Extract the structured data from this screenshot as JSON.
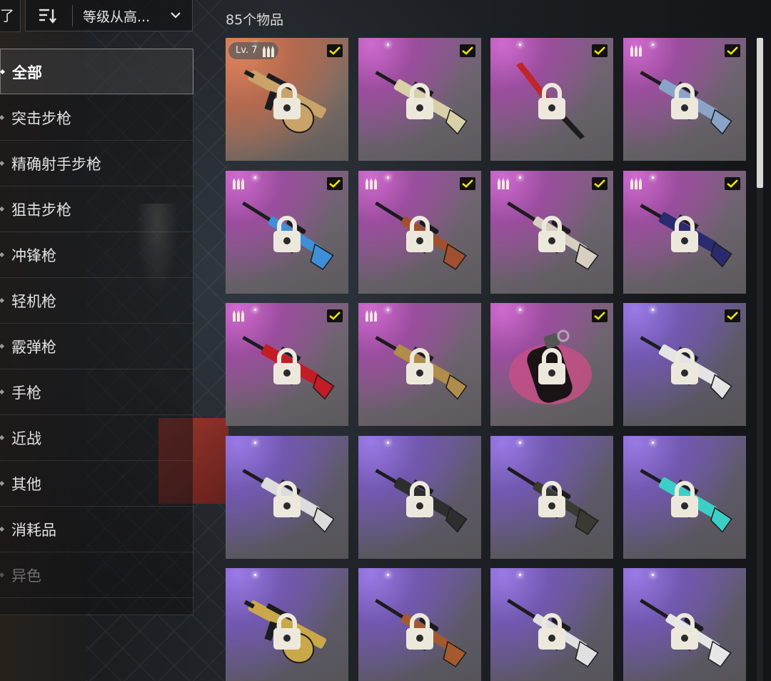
{
  "top_bar": {
    "left_stub_glyph": "了",
    "sort_icon": "sort-descending-icon",
    "sort_label": "等级从高...",
    "dropdown_icon": "chevron-down-icon"
  },
  "item_count": "85个物品",
  "sidebar": {
    "items": [
      {
        "label": "全部",
        "active": true
      },
      {
        "label": "突击步枪"
      },
      {
        "label": "精确射手步枪"
      },
      {
        "label": "狙击步枪"
      },
      {
        "label": "冲锋枪"
      },
      {
        "label": "轻机枪"
      },
      {
        "label": "霰弹枪"
      },
      {
        "label": "手枪"
      },
      {
        "label": "近战"
      },
      {
        "label": "其他"
      },
      {
        "label": "消耗品"
      },
      {
        "label": "异色",
        "disabled": true
      }
    ]
  },
  "grid": {
    "tiles": [
      {
        "rarity": "orange",
        "weapon": "smg-drum",
        "weapon_color": "#c9a36a",
        "checked": true,
        "ammo": true,
        "level": "Lv. 7",
        "locked": true
      },
      {
        "rarity": "pink",
        "weapon": "rifle",
        "weapon_color": "#d8d0a8",
        "checked": true,
        "ammo": false,
        "locked": true
      },
      {
        "rarity": "pink",
        "weapon": "machete",
        "weapon_color": "#c0252a",
        "checked": true,
        "ammo": false,
        "locked": true
      },
      {
        "rarity": "pink",
        "weapon": "rifle",
        "weapon_color": "#8aa4c8",
        "checked": true,
        "ammo": true,
        "locked": true
      },
      {
        "rarity": "pink",
        "weapon": "sniper",
        "weapon_color": "#3e8fd8",
        "checked": true,
        "ammo": true,
        "locked": true
      },
      {
        "rarity": "pink",
        "weapon": "sniper",
        "weapon_color": "#a0502e",
        "checked": true,
        "ammo": true,
        "locked": true
      },
      {
        "rarity": "pink",
        "weapon": "sniper",
        "weapon_color": "#d6cfc2",
        "checked": true,
        "ammo": true,
        "locked": true
      },
      {
        "rarity": "pink",
        "weapon": "rifle",
        "weapon_color": "#2a2a6e",
        "checked": true,
        "ammo": true,
        "locked": true
      },
      {
        "rarity": "pink",
        "weapon": "rifle",
        "weapon_color": "#c21c25",
        "checked": true,
        "ammo": true,
        "locked": true
      },
      {
        "rarity": "pink",
        "weapon": "rifle",
        "weapon_color": "#b08d4a",
        "checked": false,
        "ammo": true,
        "locked": true
      },
      {
        "rarity": "pink",
        "weapon": "grenade",
        "weapon_color": "#1a1416",
        "checked": true,
        "ammo": false,
        "locked": true
      },
      {
        "rarity": "purple",
        "weapon": "rifle",
        "weapon_color": "#e4e4e4",
        "checked": true,
        "ammo": false,
        "locked": true
      },
      {
        "rarity": "purple",
        "weapon": "rifle",
        "weapon_color": "#dcdcdc",
        "checked": false,
        "ammo": false,
        "locked": true
      },
      {
        "rarity": "purple",
        "weapon": "rifle",
        "weapon_color": "#2e2e2e",
        "checked": false,
        "ammo": false,
        "locked": true
      },
      {
        "rarity": "purple",
        "weapon": "sniper",
        "weapon_color": "#3a3a32",
        "checked": false,
        "ammo": false,
        "locked": true
      },
      {
        "rarity": "purple",
        "weapon": "rifle",
        "weapon_color": "#3ad0c8",
        "checked": false,
        "ammo": false,
        "locked": true
      },
      {
        "rarity": "purple",
        "weapon": "smg-drum",
        "weapon_color": "#c9a84a",
        "checked": false,
        "ammo": false,
        "locked": true
      },
      {
        "rarity": "purple",
        "weapon": "sniper",
        "weapon_color": "#a45a2e",
        "checked": false,
        "ammo": false,
        "locked": true
      },
      {
        "rarity": "purple",
        "weapon": "sniper",
        "weapon_color": "#e0e0e0",
        "checked": false,
        "ammo": false,
        "locked": true
      },
      {
        "rarity": "purple",
        "weapon": "sniper",
        "weapon_color": "#e6e6e6",
        "checked": false,
        "ammo": false,
        "locked": true
      }
    ],
    "icons": {
      "lock": "lock-icon",
      "check": "checkmark-icon",
      "ammo": "ammo-icon"
    },
    "colors": {
      "check": "#f2e600",
      "lock": "#ece9dc"
    }
  }
}
